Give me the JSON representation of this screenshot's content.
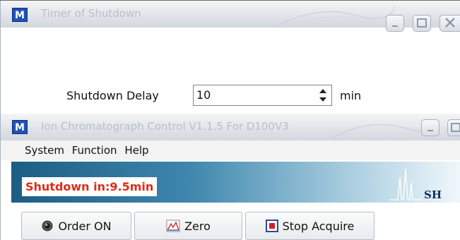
{
  "shutdown_window": {
    "icon_letter": "M",
    "title": "Timer of Shutdown",
    "delay_label": "Shutdown Delay",
    "delay_value": "10",
    "unit": "min",
    "min_icon": "minimize-icon",
    "max_icon": "maximize-icon",
    "close_icon": "close-icon"
  },
  "main_window": {
    "icon_letter": "M",
    "title": "Ion Chromatograph Control V1.1.5 For D100V3",
    "menu": [
      "System",
      "Function",
      "Help"
    ],
    "status_text": "Shutdown in:9.5min",
    "logo_text": "SH",
    "buttons": [
      {
        "label": "Order ON",
        "icon": "status-dot-icon"
      },
      {
        "label": "Zero",
        "icon": "chart-zero-icon"
      },
      {
        "label": "Stop Acquire",
        "icon": "stop-record-icon"
      }
    ]
  },
  "colors": {
    "status_text": "#e02a18",
    "banner_start": "#1d5d83",
    "banner_end": "#f0f7fb",
    "icon_blue": "#1f52b7"
  }
}
